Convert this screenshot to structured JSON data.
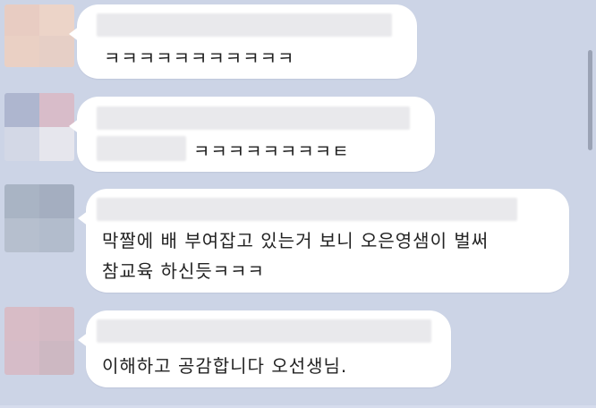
{
  "chat": {
    "messages": [
      {
        "text": "ㅋㅋㅋㅋㅋㅋㅋㅋㅋㅋㅋ"
      },
      {
        "text": "ㅋㅋㅋㅋㅋㅋㅋㅋㅌ"
      },
      {
        "line1": "막짤에 배 부여잡고 있는거 보니 오은영샘이 벌써",
        "line2": "참교육 하신듯ㅋㅋㅋ"
      },
      {
        "text": "이해하고 공감합니다 오선생님."
      }
    ]
  }
}
